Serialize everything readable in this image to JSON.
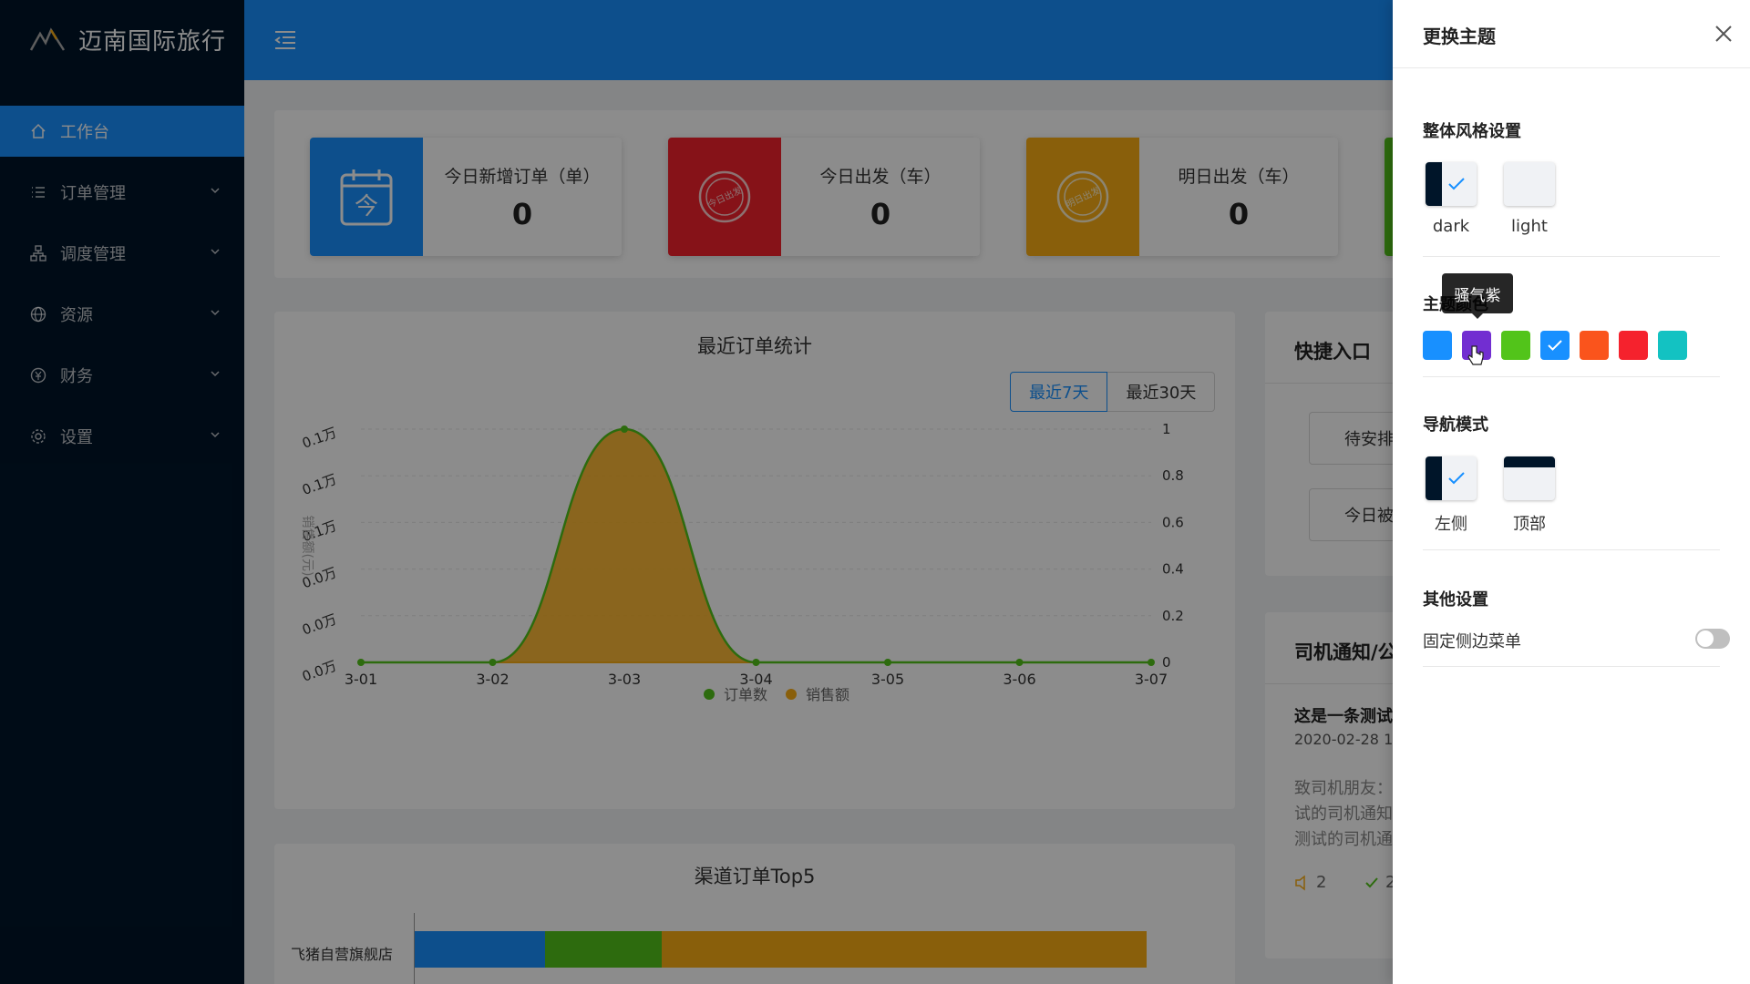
{
  "app": {
    "logo_text": "迈南国际旅行"
  },
  "sidebar": {
    "items": [
      {
        "label": "工作台",
        "icon": "home-icon",
        "active": true
      },
      {
        "label": "订单管理",
        "icon": "list-icon",
        "active": false
      },
      {
        "label": "调度管理",
        "icon": "cluster-icon",
        "active": false
      },
      {
        "label": "资源",
        "icon": "global-icon",
        "active": false
      },
      {
        "label": "财务",
        "icon": "money-icon",
        "active": false
      },
      {
        "label": "设置",
        "icon": "gear-icon",
        "active": false
      }
    ]
  },
  "stats": [
    {
      "label": "今日新增订单（单）",
      "value": "0",
      "color": "#1890ff",
      "icon": "calendar-today-icon",
      "stamp": "今"
    },
    {
      "label": "今日出发（车）",
      "value": "0",
      "color": "#f5222d",
      "icon": "stamp-today-depart-icon",
      "stamp": "今日出发"
    },
    {
      "label": "明日出发（车）",
      "value": "0",
      "color": "#faad14",
      "icon": "stamp-tomorrow-depart-icon",
      "stamp": "明日出发"
    }
  ],
  "chart_section": {
    "range_buttons": [
      "最近7天",
      "最近30天"
    ],
    "active_range": "最近7天"
  },
  "chart_data": {
    "type": "area",
    "title": "最近订单统计",
    "x": [
      "3-01",
      "3-02",
      "3-03",
      "3-04",
      "3-05",
      "3-06",
      "3-07"
    ],
    "series": [
      {
        "name": "订单数",
        "values": [
          0,
          0,
          1,
          0,
          0,
          0,
          0
        ],
        "color": "#52c41a",
        "axis": "right"
      },
      {
        "name": "销售额",
        "values": [
          0,
          0,
          0,
          0,
          0,
          0,
          0
        ],
        "color": "#faad14",
        "axis": "left"
      }
    ],
    "ylabel_left": "销售额(元)",
    "yticks_left": [
      "0.0万",
      "0.0万",
      "0.0万",
      "0.1万",
      "0.1万",
      "0.1万"
    ],
    "yticks_right": [
      "0",
      "0.2",
      "0.4",
      "0.6",
      "0.8",
      "1"
    ],
    "ylim_right": [
      0,
      1
    ],
    "legend_position": "bottom"
  },
  "quick": {
    "title": "快捷入口",
    "buttons": [
      "待安排",
      "今日被"
    ]
  },
  "notice": {
    "title": "司机通知/公",
    "item_title": "这是一条测试",
    "item_date": "2020-02-28 1",
    "body_lines": [
      "致司机朋友：",
      "试的司机通知",
      "测试的司机通"
    ],
    "reads": "2",
    "confirms": "2"
  },
  "top5": {
    "title": "渠道订单Top5",
    "rows": [
      {
        "label": "飞猪自营旗舰店",
        "segments": [
          {
            "color": "#1890ff",
            "share": 0.178
          },
          {
            "color": "#52c41a",
            "share": 0.159
          },
          {
            "color": "#faad14",
            "share": 0.663
          }
        ]
      }
    ]
  },
  "drawer": {
    "title": "更换主题",
    "style_section": "整体风格设置",
    "style_options": [
      "dark",
      "light"
    ],
    "theme_section": "主题颜色",
    "tooltip": "骚气紫",
    "swatches": [
      "#1890ff",
      "#722ed1",
      "#52c41a",
      "#1890ff",
      "#fa541c",
      "#f5222d",
      "#13c2c2"
    ],
    "selected_swatch": 3,
    "nav_section": "导航模式",
    "nav_options": [
      "左侧",
      "顶部"
    ],
    "other_section": "其他设置",
    "fixed_sidebar_label": "固定侧边菜单",
    "fixed_sidebar_on": false
  }
}
